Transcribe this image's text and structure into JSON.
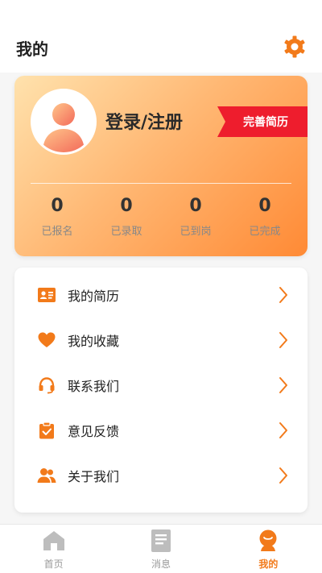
{
  "header": {
    "title": "我的",
    "settings_icon": "gear-icon"
  },
  "profile": {
    "avatar_icon": "user-avatar-icon",
    "login_label": "登录/注册",
    "resume_badge": "完善简历",
    "stats": [
      {
        "value": "0",
        "label": "已报名"
      },
      {
        "value": "0",
        "label": "已录取"
      },
      {
        "value": "0",
        "label": "已到岗"
      },
      {
        "value": "0",
        "label": "已完成"
      }
    ]
  },
  "menu": [
    {
      "label": "我的简历",
      "icon": "resume-card-icon"
    },
    {
      "label": "我的收藏",
      "icon": "heart-icon"
    },
    {
      "label": "联系我们",
      "icon": "headset-icon"
    },
    {
      "label": "意见反馈",
      "icon": "clipboard-check-icon"
    },
    {
      "label": "关于我们",
      "icon": "users-icon"
    }
  ],
  "tabbar": {
    "tabs": [
      {
        "label": "首页",
        "icon": "home-icon"
      },
      {
        "label": "消息",
        "icon": "document-icon"
      },
      {
        "label": "我的",
        "icon": "profile-icon",
        "active": true
      }
    ]
  },
  "colors": {
    "accent": "#f27a1a",
    "badge": "#ee1d2d",
    "icon_gray": "#bdbdbd"
  }
}
